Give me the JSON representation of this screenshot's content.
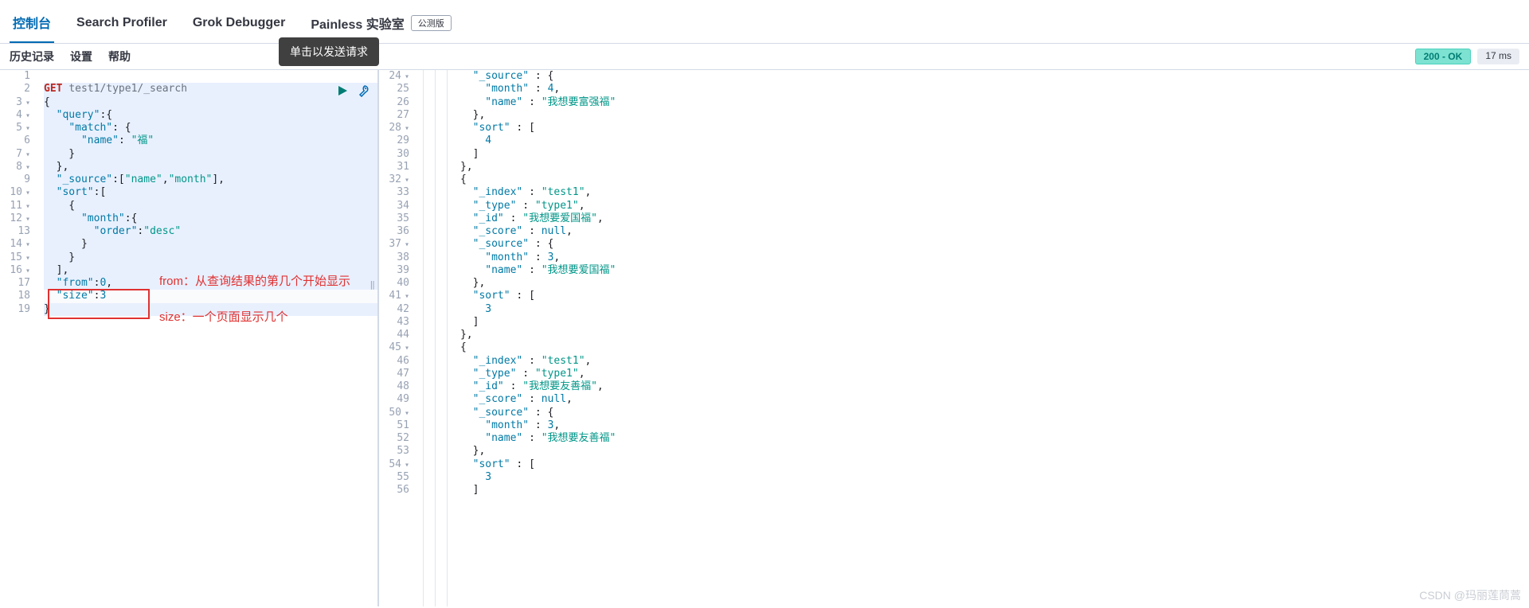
{
  "tabs": {
    "console": "控制台",
    "search_profiler": "Search Profiler",
    "grok_debugger": "Grok Debugger",
    "painless_lab": "Painless 实验室",
    "beta_badge": "公测版"
  },
  "sub": {
    "history": "历史记录",
    "settings": "设置",
    "help": "帮助"
  },
  "status": {
    "text": "200 - OK",
    "timing": "17 ms"
  },
  "tooltip": "单击以发送请求",
  "request": {
    "method": "GET",
    "url": "test1/type1/_search",
    "lines": [
      "{",
      "  \"query\":{",
      "    \"match\": {",
      "      \"name\": \"福\"",
      "    }",
      "  },",
      "  \"_source\":[\"name\",\"month\"],",
      "  \"sort\":[",
      "    {",
      "      \"month\":{",
      "        \"order\":\"desc\"",
      "      }",
      "    }",
      "  ],",
      "  \"from\":0,",
      "  \"size\":3",
      "}"
    ]
  },
  "annotations": {
    "from": "from：从查询结果的第几个开始显示",
    "size": "size：一个页面显示几个"
  },
  "response_lines": [
    {
      "n": 24,
      "t": "        \"_source\" : {"
    },
    {
      "n": 25,
      "t": "          \"month\" : 4,"
    },
    {
      "n": 26,
      "t": "          \"name\" : \"我想要富强福\""
    },
    {
      "n": 27,
      "t": "        },"
    },
    {
      "n": 28,
      "t": "        \"sort\" : ["
    },
    {
      "n": 29,
      "t": "          4"
    },
    {
      "n": 30,
      "t": "        ]"
    },
    {
      "n": 31,
      "t": "      },"
    },
    {
      "n": 32,
      "t": "      {"
    },
    {
      "n": 33,
      "t": "        \"_index\" : \"test1\","
    },
    {
      "n": 34,
      "t": "        \"_type\" : \"type1\","
    },
    {
      "n": 35,
      "t": "        \"_id\" : \"我想要爱国福\","
    },
    {
      "n": 36,
      "t": "        \"_score\" : null,"
    },
    {
      "n": 37,
      "t": "        \"_source\" : {"
    },
    {
      "n": 38,
      "t": "          \"month\" : 3,"
    },
    {
      "n": 39,
      "t": "          \"name\" : \"我想要爱国福\""
    },
    {
      "n": 40,
      "t": "        },"
    },
    {
      "n": 41,
      "t": "        \"sort\" : ["
    },
    {
      "n": 42,
      "t": "          3"
    },
    {
      "n": 43,
      "t": "        ]"
    },
    {
      "n": 44,
      "t": "      },"
    },
    {
      "n": 45,
      "t": "      {"
    },
    {
      "n": 46,
      "t": "        \"_index\" : \"test1\","
    },
    {
      "n": 47,
      "t": "        \"_type\" : \"type1\","
    },
    {
      "n": 48,
      "t": "        \"_id\" : \"我想要友善福\","
    },
    {
      "n": 49,
      "t": "        \"_score\" : null,"
    },
    {
      "n": 50,
      "t": "        \"_source\" : {"
    },
    {
      "n": 51,
      "t": "          \"month\" : 3,"
    },
    {
      "n": 52,
      "t": "          \"name\" : \"我想要友善福\""
    },
    {
      "n": 53,
      "t": "        },"
    },
    {
      "n": 54,
      "t": "        \"sort\" : ["
    },
    {
      "n": 55,
      "t": "          3"
    },
    {
      "n": 56,
      "t": "        ]"
    }
  ],
  "watermark": "CSDN @玛丽莲茼蒿"
}
